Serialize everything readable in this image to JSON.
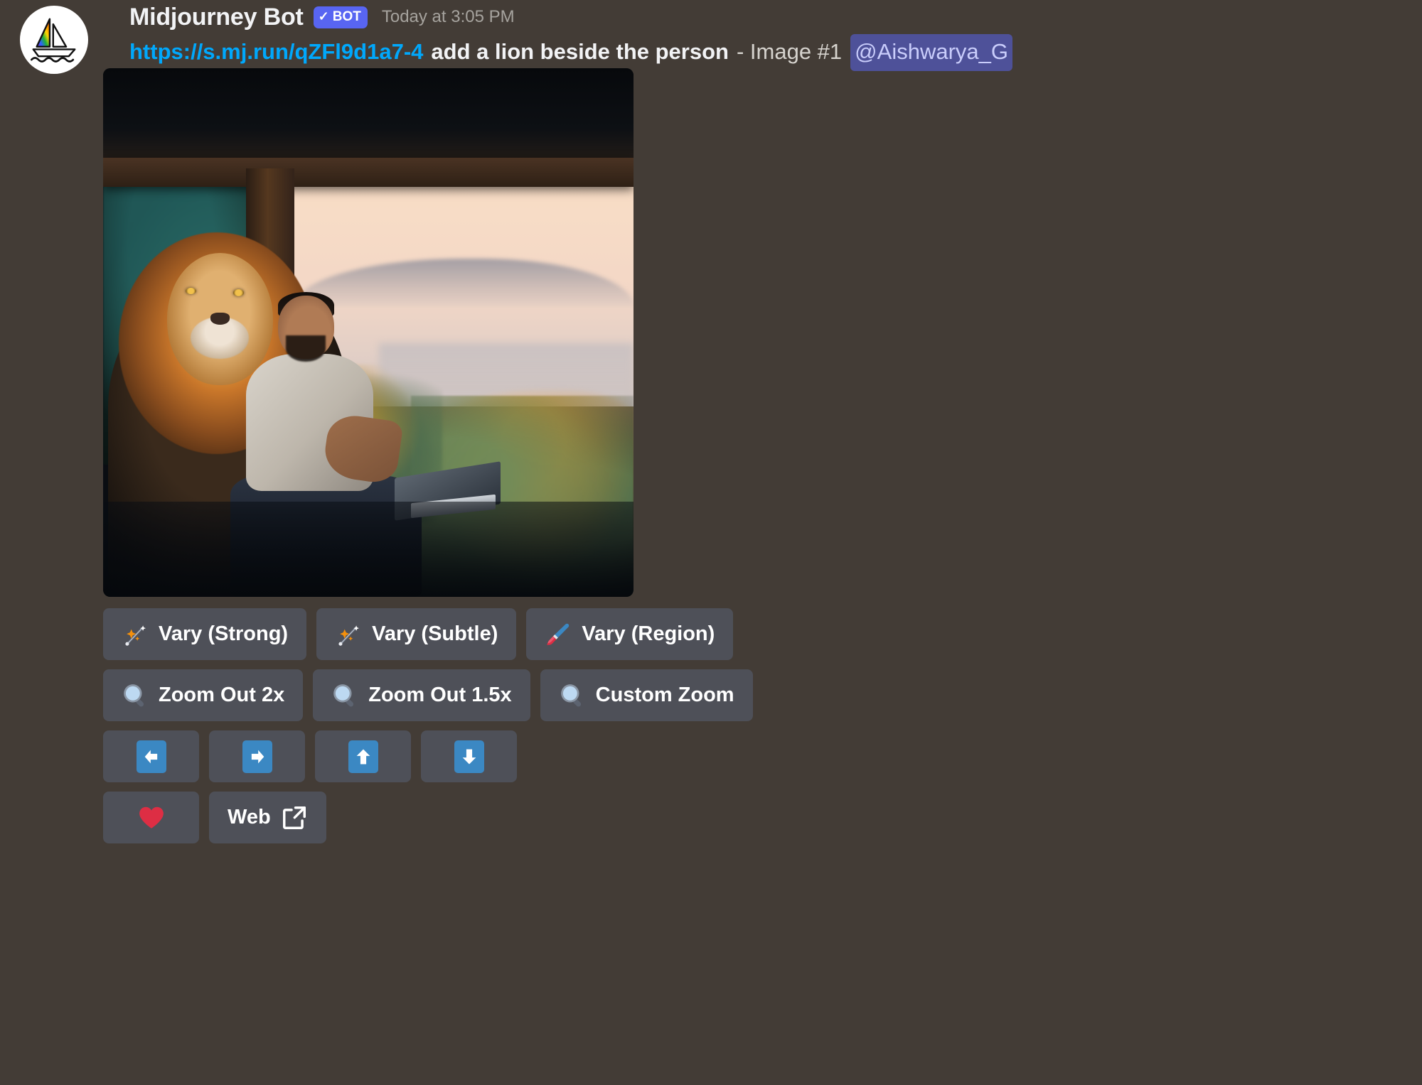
{
  "message": {
    "author": "Midjourney Bot",
    "bot_badge": "BOT",
    "bot_badge_check": "✓",
    "timestamp": "Today at 3:05 PM",
    "link_text": "https://s.mj.run/qZFl9d1a7-4",
    "prompt": "add a lion beside the person",
    "meta": "- Image #1",
    "mention": "@Aishwarya_G",
    "avatar_alt": "midjourney-sailboat-logo",
    "image_alt": "Generated image: man in white t-shirt seated with a lion beside him, overlooking a hazy valley and river at sunset"
  },
  "colors": {
    "background": "#433C36",
    "link": "#00A8FC",
    "bot_badge_bg": "#5865F2",
    "mention_bg": "#4E5199",
    "mention_text": "#C9CDFB",
    "button_bg": "#4E5058",
    "button_text": "#FFFFFF",
    "timestamp_text": "#A6A39E",
    "arrow_emoji_bg": "#3B88C3",
    "heart_red": "#DD2E44"
  },
  "buttons": {
    "row1": [
      {
        "icon": "sparkle-wand-icon",
        "label": "Vary (Strong)"
      },
      {
        "icon": "sparkle-wand-icon",
        "label": "Vary (Subtle)"
      },
      {
        "icon": "paintbrush-icon",
        "label": "Vary (Region)"
      }
    ],
    "row2": [
      {
        "icon": "magnifying-glass-icon",
        "label": "Zoom Out 2x"
      },
      {
        "icon": "magnifying-glass-icon",
        "label": "Zoom Out 1.5x"
      },
      {
        "icon": "magnifying-glass-icon",
        "label": "Custom Zoom"
      }
    ],
    "row3": [
      {
        "icon": "arrow-left-icon",
        "label": ""
      },
      {
        "icon": "arrow-right-icon",
        "label": ""
      },
      {
        "icon": "arrow-up-icon",
        "label": ""
      },
      {
        "icon": "arrow-down-icon",
        "label": ""
      }
    ],
    "row4": [
      {
        "icon": "heart-icon",
        "label": ""
      },
      {
        "icon": "external-link-icon",
        "label": "Web"
      }
    ]
  }
}
